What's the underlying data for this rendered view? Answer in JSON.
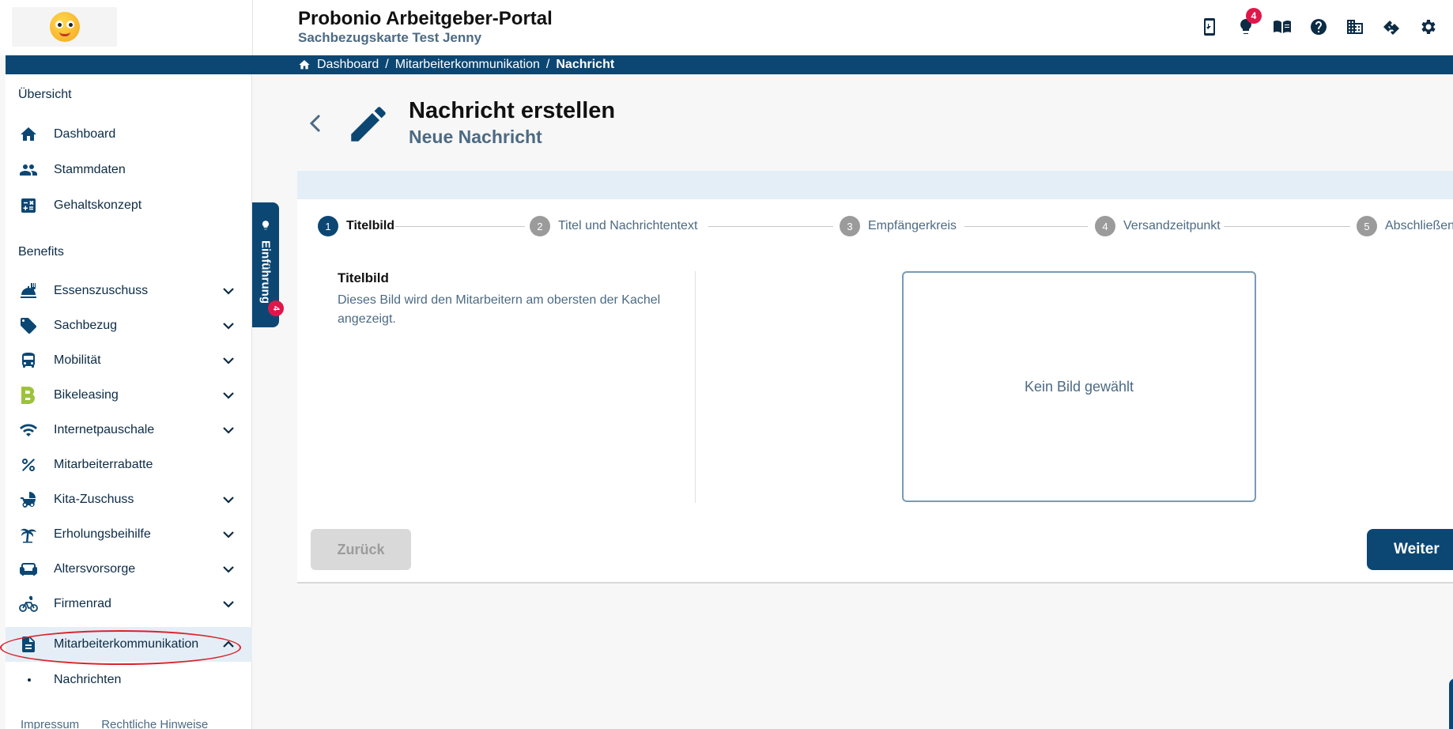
{
  "header": {
    "title": "Probonio Arbeitgeber-Portal",
    "subtitle": "Sachbezugskarte Test Jenny",
    "notification_count": "4",
    "icons": [
      "mobile-share-icon",
      "lightbulb-icon",
      "book-icon",
      "help-icon",
      "building-icon",
      "handshake-icon",
      "gear-icon"
    ]
  },
  "breadcrumb": {
    "home": "Dashboard",
    "middle": "Mitarbeiterkommunikation",
    "current": "Nachricht",
    "separator": "/"
  },
  "sidebar": {
    "overview_heading": "Übersicht",
    "overview_items": [
      {
        "label": "Dashboard",
        "icon": "home-icon"
      },
      {
        "label": "Stammdaten",
        "icon": "people-icon"
      },
      {
        "label": "Gehaltskonzept",
        "icon": "calculator-icon"
      }
    ],
    "benefits_heading": "Benefits",
    "benefit_items": [
      {
        "label": "Essenszuschuss",
        "icon": "food-icon",
        "expandable": true
      },
      {
        "label": "Sachbezug",
        "icon": "tag-icon",
        "expandable": true
      },
      {
        "label": "Mobilität",
        "icon": "bus-icon",
        "expandable": true
      },
      {
        "label": "Bikeleasing",
        "icon": "bikeleasing-logo-icon",
        "expandable": true
      },
      {
        "label": "Internetpauschale",
        "icon": "wifi-icon",
        "expandable": true
      },
      {
        "label": "Mitarbeiterrabatte",
        "icon": "percent-icon",
        "expandable": false
      },
      {
        "label": "Kita-Zuschuss",
        "icon": "stroller-icon",
        "expandable": true
      },
      {
        "label": "Erholungsbeihilfe",
        "icon": "palm-tree-icon",
        "expandable": true
      },
      {
        "label": "Altersvorsorge",
        "icon": "sofa-icon",
        "expandable": true
      },
      {
        "label": "Firmenrad",
        "icon": "cyclist-icon",
        "expandable": true
      },
      {
        "label": "Mitarbeiterkommunikation",
        "icon": "document-icon",
        "expandable": true,
        "active": true
      }
    ],
    "sub_items": [
      {
        "label": "Nachrichten"
      }
    ],
    "footer": {
      "impressum": "Impressum",
      "legal": "Rechtliche Hinweise"
    }
  },
  "intro_tab": {
    "label": "Einführung",
    "badge": "4"
  },
  "page": {
    "title": "Nachricht erstellen",
    "subtitle": "Neue Nachricht"
  },
  "stepper": {
    "steps": [
      {
        "num": "1",
        "label": "Titelbild",
        "active": true
      },
      {
        "num": "2",
        "label": "Titel und Nachrichtentext",
        "active": false
      },
      {
        "num": "3",
        "label": "Empfängerkreis",
        "active": false
      },
      {
        "num": "4",
        "label": "Versandzeitpunkt",
        "active": false
      },
      {
        "num": "5",
        "label": "Abschließen",
        "active": false
      }
    ]
  },
  "form": {
    "section_title": "Titelbild",
    "section_description": "Dieses Bild wird den Mitarbeitern am obersten der Kachel angezeigt.",
    "image_placeholder": "Kein Bild gewählt"
  },
  "buttons": {
    "back": "Zurück",
    "next": "Weiter"
  },
  "colors": {
    "primary": "#0c4773",
    "badge": "#e0164a",
    "highlight": "#d9232e"
  }
}
